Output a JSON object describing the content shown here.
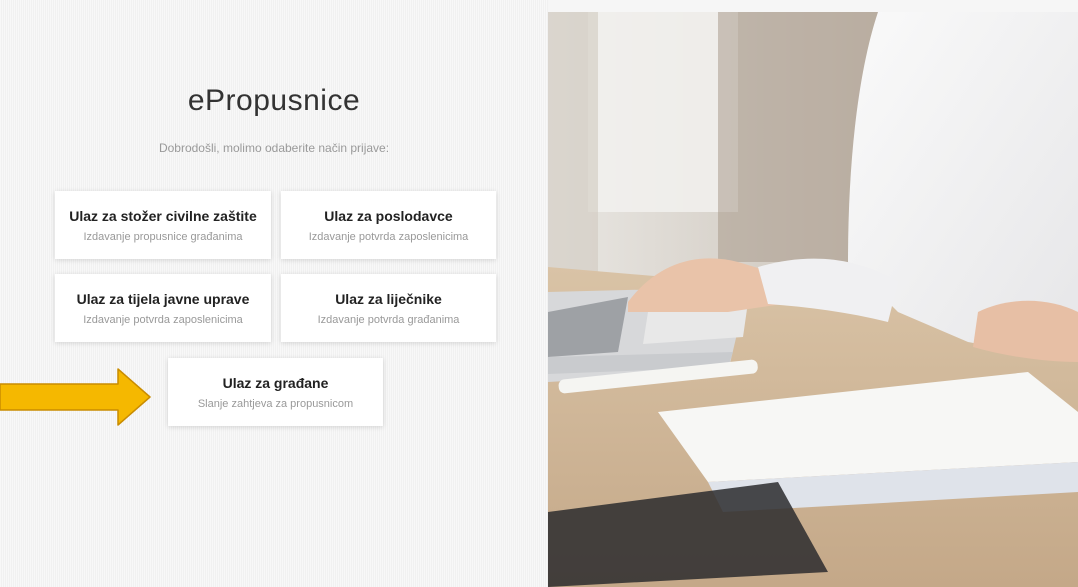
{
  "app": {
    "title": "ePropusnice",
    "subtitle": "Dobrodošli, molimo odaberite način prijave:"
  },
  "login_options": [
    {
      "title": "Ulaz za stožer civilne zaštite",
      "subtitle": "Izdavanje propusnice građanima"
    },
    {
      "title": "Ulaz za poslodavce",
      "subtitle": "Izdavanje potvrda zaposlenicima"
    },
    {
      "title": "Ulaz za tijela javne uprave",
      "subtitle": "Izdavanje potvrda zaposlenicima"
    },
    {
      "title": "Ulaz za liječnike",
      "subtitle": "Izdavanje potvrda građanima"
    },
    {
      "title": "Ulaz za građane",
      "subtitle": "Slanje zahtjeva za propusnicom"
    }
  ],
  "annotation": {
    "icon": "arrow-right-icon",
    "color": "#f5b800",
    "outline": "#c98c00"
  },
  "hero_image": {
    "icon": "workspace-photo"
  }
}
